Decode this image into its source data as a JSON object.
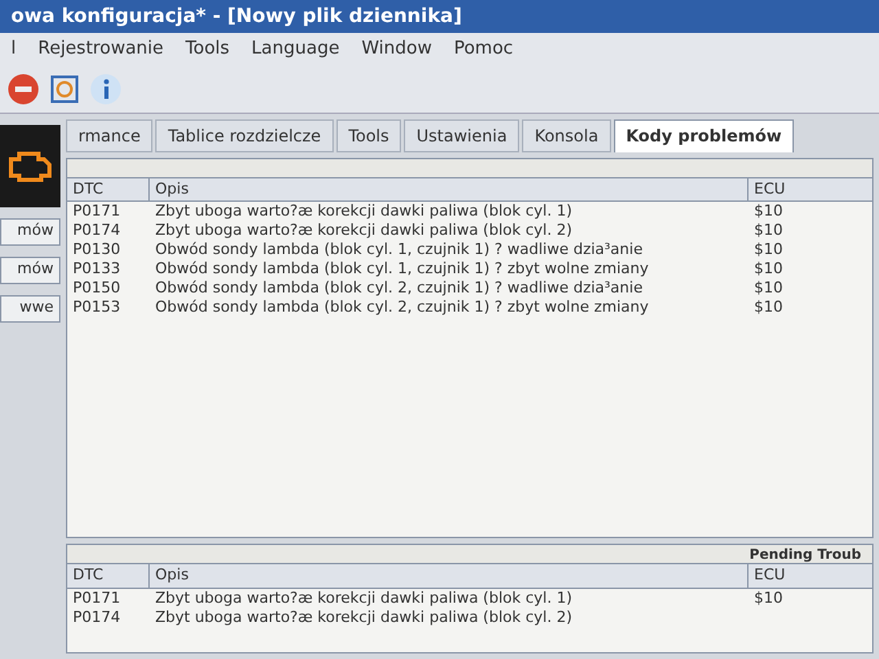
{
  "window": {
    "title": "owa konfiguracja* - [Nowy plik dziennika]"
  },
  "menu": [
    "l",
    "Rejestrowanie",
    "Tools",
    "Language",
    "Window",
    "Pomoc"
  ],
  "side_buttons": [
    "mów",
    "mów",
    "wwe"
  ],
  "tabs": [
    {
      "label": "rmance",
      "selected": false
    },
    {
      "label": "Tablice rozdzielcze",
      "selected": false
    },
    {
      "label": "Tools",
      "selected": false
    },
    {
      "label": "Ustawienia",
      "selected": false
    },
    {
      "label": "Konsola",
      "selected": false
    },
    {
      "label": "Kody problemów",
      "selected": true
    }
  ],
  "main_table": {
    "columns": [
      "DTC",
      "Opis",
      "ECU"
    ],
    "dtc": [
      "P0171",
      "P0174",
      "P0130",
      "P0133",
      "P0150",
      "P0153"
    ],
    "rows": [
      {
        "opis": "Zbyt uboga warto?æ korekcji dawki paliwa (blok cyl. 1)",
        "ecu": "$10"
      },
      {
        "opis": "Zbyt uboga warto?æ korekcji dawki paliwa (blok cyl. 2)",
        "ecu": "$10"
      },
      {
        "opis": "Obwód sondy lambda (blok cyl. 1, czujnik 1) ? wadliwe dzia³anie",
        "ecu": "$10"
      },
      {
        "opis": "Obwód sondy lambda (blok cyl. 1, czujnik 1) ? zbyt wolne zmiany",
        "ecu": "$10"
      },
      {
        "opis": "Obwód sondy lambda (blok cyl. 2, czujnik 1) ? wadliwe dzia³anie",
        "ecu": "$10"
      },
      {
        "opis": "Obwód sondy lambda (blok cyl. 2, czujnik 1) ? zbyt wolne zmiany",
        "ecu": "$10"
      }
    ]
  },
  "pending_table": {
    "title": "Pending Troub",
    "columns": [
      "DTC",
      "Opis",
      "ECU"
    ],
    "dtc": [
      "P0171",
      "P0174"
    ],
    "rows": [
      {
        "opis": "Zbyt uboga warto?æ korekcji dawki paliwa (blok cyl. 1)",
        "ecu": "$10"
      },
      {
        "opis": "Zbyt uboga warto?æ korekcji dawki paliwa (blok cyl. 2)"
      }
    ]
  }
}
